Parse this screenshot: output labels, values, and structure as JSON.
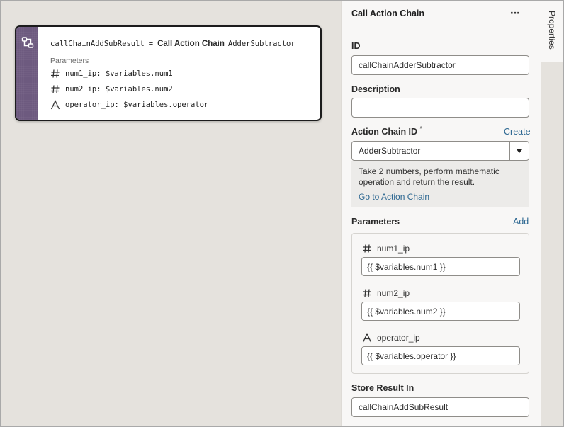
{
  "canvas": {
    "card": {
      "result_var": "callChainAddSubResult",
      "equals": "=",
      "kind": "Call Action Chain",
      "chain_name": "AdderSubtractor",
      "params_label": "Parameters",
      "params": [
        {
          "icon": "hash-icon",
          "text": "num1_ip: $variables.num1"
        },
        {
          "icon": "hash-icon",
          "text": "num2_ip: $variables.num2"
        },
        {
          "icon": "text-type-icon",
          "text": "operator_ip: $variables.operator"
        }
      ]
    }
  },
  "panel": {
    "title": "Call Action Chain",
    "more_label": "⋯",
    "id_label": "ID",
    "id_value": "callChainAdderSubtractor",
    "description_label": "Description",
    "description_value": "",
    "action_chain_label": "Action Chain ID",
    "required_mark": "*",
    "create_link": "Create",
    "action_chain_value": "AdderSubtractor",
    "chain_description": "Take 2 numbers, perform mathematic operation and return the result.",
    "goto_link": "Go to Action Chain",
    "parameters_label": "Parameters",
    "add_link": "Add",
    "parameters": [
      {
        "name": "num1_ip",
        "icon": "hash-icon",
        "value": "{{ $variables.num1 }}"
      },
      {
        "name": "num2_ip",
        "icon": "hash-icon",
        "value": "{{ $variables.num2 }}"
      },
      {
        "name": "operator_ip",
        "icon": "text-type-icon",
        "value": "{{ $variables.operator }}"
      }
    ],
    "store_result_label": "Store Result In",
    "store_result_value": "callChainAddSubResult"
  },
  "tabs": {
    "properties": "Properties"
  },
  "colors": {
    "accent_purple": "#6d5a7f",
    "link_blue": "#2c6791",
    "canvas_bg": "#e5e2dd"
  }
}
